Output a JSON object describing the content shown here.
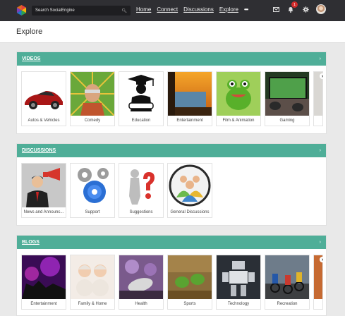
{
  "topbar": {
    "search_placeholder": "Search SocialEngine",
    "nav": [
      "Home",
      "Connect",
      "Discussions",
      "Explore"
    ],
    "more": "•••",
    "notification_count": "1"
  },
  "page": {
    "title": "Explore"
  },
  "sections": {
    "videos": {
      "title": "VIDEOS",
      "items": [
        "Autos & Vehicles",
        "Comedy",
        "Education",
        "Entertainment",
        "Film & Animation",
        "Gaming"
      ]
    },
    "discussions": {
      "title": "DISCUSSIONS",
      "items": [
        "News and Announc...",
        "Support",
        "Suggestions",
        "General Discussions"
      ]
    },
    "blogs": {
      "title": "BLOGS",
      "items": [
        "Entertainment",
        "Family & Home",
        "Health",
        "Sports",
        "Technology",
        "Recreation"
      ]
    }
  },
  "colors": {
    "topbar": "#2f2f33",
    "section_header": "#4fae98",
    "badge": "#d22b2b"
  }
}
